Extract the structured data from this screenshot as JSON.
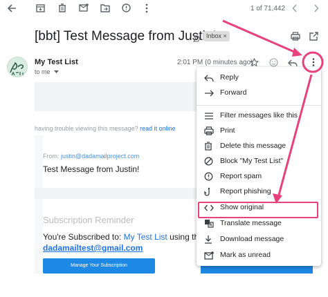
{
  "toolbar": {
    "icons": [
      "back-arrow-icon",
      "archive-icon",
      "trash-icon",
      "mark-unread-icon",
      "move-to-icon",
      "report-spam-icon",
      "more-icon"
    ],
    "pagination": "1 of 71,442"
  },
  "email": {
    "subject": "[bbt] Test Message from Justin!",
    "label_chip": "Inbox",
    "label_chip_close": "×",
    "sender_name": "My Test List",
    "to_line": "to me",
    "time": "2:01 PM (0 minutes ago)"
  },
  "body": {
    "trouble_text": "having trouble viewing this message?",
    "trouble_link": "read it online",
    "from_label": "From:",
    "from_email": "justin@dadamailproject.com",
    "message_title": "Test Message from Justin!",
    "subscription_heading": "Subscription Reminder",
    "subscribed_prefix": "You're Subscribed to:",
    "subscribed_list": "My Test List",
    "subscribed_suffix": "using the",
    "subscriber_email": "dadamailtest@gmail.com",
    "manage_button": "Manage Your Subscription"
  },
  "menu": {
    "items": [
      {
        "label": "Reply",
        "icon": "reply-icon"
      },
      {
        "label": "Forward",
        "icon": "forward-icon"
      },
      {
        "label": "Filter messages like this",
        "icon": "filter-icon"
      },
      {
        "label": "Print",
        "icon": "print-icon"
      },
      {
        "label": "Delete this message",
        "icon": "trash-icon"
      },
      {
        "label": "Block \"My Test List\"",
        "icon": "block-icon"
      },
      {
        "label": "Report spam",
        "icon": "spam-icon"
      },
      {
        "label": "Report phishing",
        "icon": "phishing-hook-icon"
      },
      {
        "label": "Show original",
        "icon": "code-icon"
      },
      {
        "label": "Translate message",
        "icon": "translate-icon"
      },
      {
        "label": "Download message",
        "icon": "download-icon"
      },
      {
        "label": "Mark as unread",
        "icon": "mark-unread-icon"
      }
    ],
    "highlighted": "Show original"
  },
  "colors": {
    "annotation": "#e8407a",
    "link": "#1a73e8",
    "button": "#1e88e5"
  }
}
